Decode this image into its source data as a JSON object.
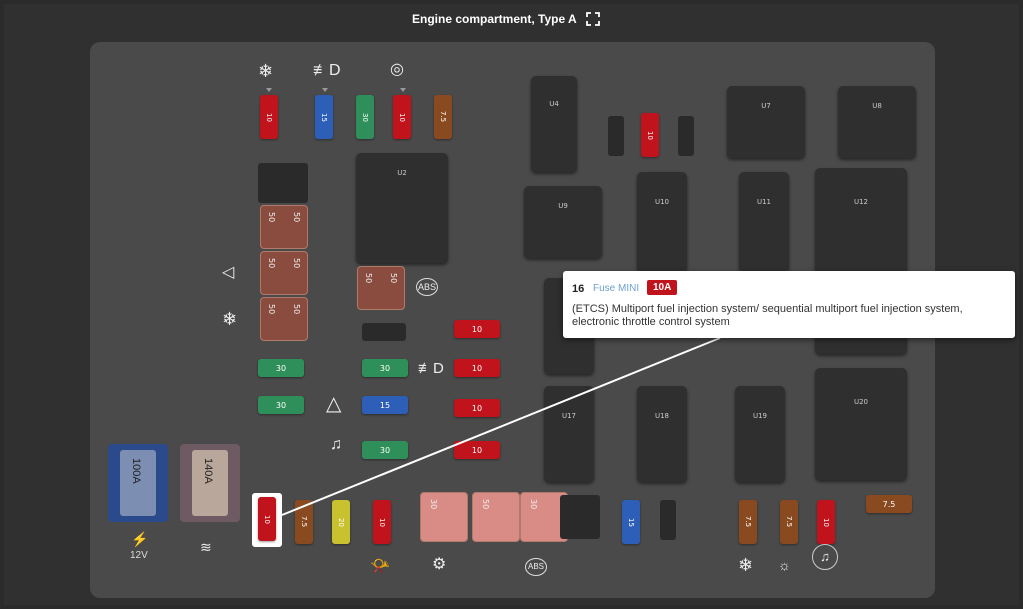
{
  "header": {
    "title": "Engine compartment, Type A",
    "expand_icon": "fullscreen-icon"
  },
  "relays": {
    "u2": "U2",
    "u4": "U4",
    "u7": "U7",
    "u8": "U8",
    "u9": "U9",
    "u10": "U10",
    "u11": "U11",
    "u12": "U12",
    "u17": "U17",
    "u18": "U18",
    "u19": "U19",
    "u20": "U20"
  },
  "fuses_top": [
    "10",
    "15",
    "30",
    "10",
    "7.5"
  ],
  "fuse_u4": "10",
  "fuses_bottom": [
    "10",
    "7.5",
    "20",
    "10"
  ],
  "fuses_right": [
    "7.5",
    "7.5",
    "10"
  ],
  "fuse_15_bottom": "15",
  "flat_left": [
    "30",
    "30",
    "30"
  ],
  "flat_mid": [
    "30",
    "30",
    "15",
    "30"
  ],
  "flat_right": [
    "10",
    "10",
    "10",
    "10"
  ],
  "flat_far_right": "7.5",
  "cartridges": {
    "left": [
      "50",
      "50",
      "50"
    ],
    "mid": "50",
    "bottom": [
      [
        "30",
        "30"
      ],
      [
        "50",
        "30"
      ],
      [
        "30",
        "30"
      ]
    ]
  },
  "big_fuses": [
    "100A",
    "140A"
  ],
  "label_12v": "12V",
  "tooltip": {
    "number": "16",
    "type": "Fuse MINI",
    "amperage": "10A",
    "description": "(ETCS) Multiport fuel injection system/ sequential multiport fuel injection system, electronic throttle control system"
  },
  "colors": {
    "red": "#c0131b",
    "blue": "#2e5fb8",
    "green": "#2f8f5a",
    "brown": "#8a4a1f",
    "yellow": "#c8c22e"
  }
}
